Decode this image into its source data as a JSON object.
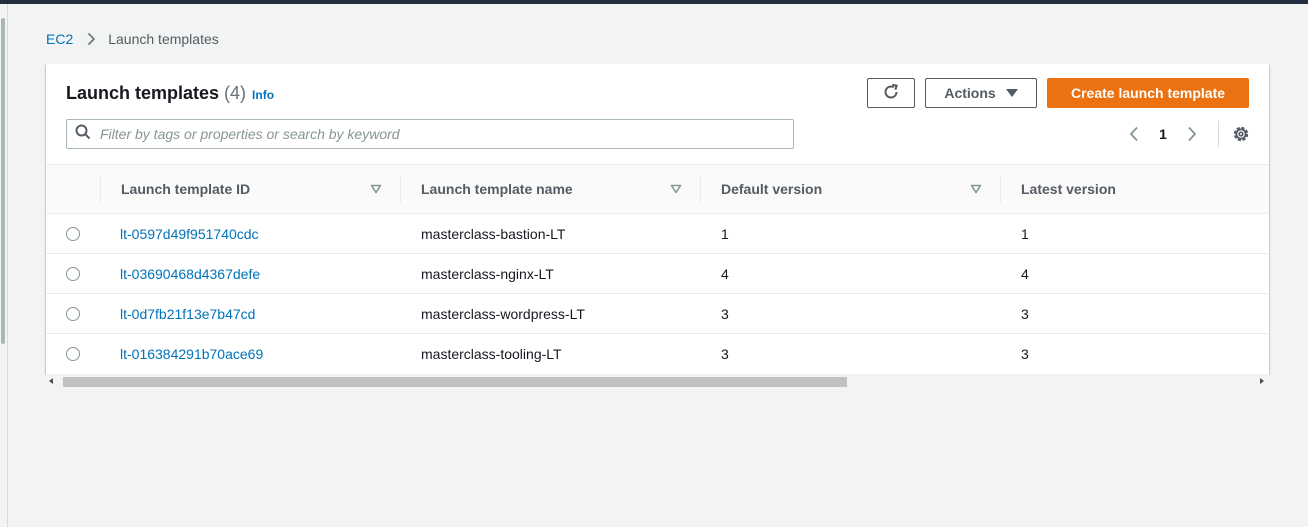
{
  "breadcrumb": {
    "root": "EC2",
    "current": "Launch templates"
  },
  "header": {
    "title": "Launch templates",
    "count": "(4)",
    "info": "Info"
  },
  "toolbar": {
    "actions_label": "Actions",
    "create_label": "Create launch template"
  },
  "search": {
    "placeholder": "Filter by tags or properties or search by keyword"
  },
  "pagination": {
    "current_page": "1"
  },
  "table": {
    "columns": [
      "Launch template ID",
      "Launch template name",
      "Default version",
      "Latest version"
    ],
    "rows": [
      {
        "id": "lt-0597d49f951740cdc",
        "name": "masterclass-bastion-LT",
        "default_version": "1",
        "latest_version": "1"
      },
      {
        "id": "lt-03690468d4367defe",
        "name": "masterclass-nginx-LT",
        "default_version": "4",
        "latest_version": "4"
      },
      {
        "id": "lt-0d7fb21f13e7b47cd",
        "name": "masterclass-wordpress-LT",
        "default_version": "3",
        "latest_version": "3"
      },
      {
        "id": "lt-016384291b70ace69",
        "name": "masterclass-tooling-LT",
        "default_version": "3",
        "latest_version": "3"
      }
    ]
  },
  "colors": {
    "accent": "#ec7211",
    "link": "#0073bb",
    "topbar": "#232f3e"
  },
  "icons": {
    "refresh": "refresh-icon",
    "caret": "caret-down-icon",
    "search": "search-icon",
    "settings": "gear-icon"
  }
}
